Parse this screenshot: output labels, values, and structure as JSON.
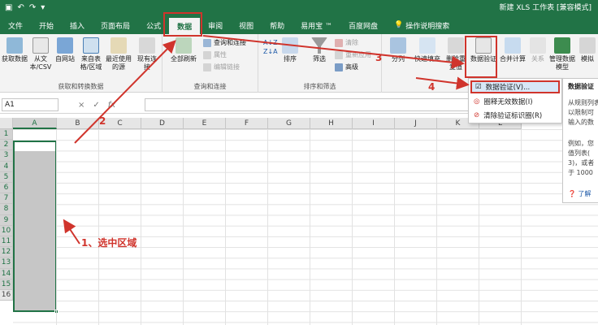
{
  "titlebar": {
    "title": "新建 XLS 工作表 [兼容模式]",
    "save_icon": "save-icon",
    "undo_icon": "undo-icon",
    "redo_icon": "redo-icon"
  },
  "tabs": [
    "文件",
    "开始",
    "插入",
    "页面布局",
    "公式",
    "数据",
    "审阅",
    "视图",
    "帮助",
    "易用宝 ™",
    "百度网盘",
    "操作说明搜索"
  ],
  "ribbon": {
    "get_group": {
      "label": "获取和转换数据",
      "buttons": [
        "获取数据",
        "从文本/CSV",
        "自网站",
        "来自表格/区域",
        "最近使用的源",
        "现有连接"
      ]
    },
    "query_group": {
      "label": "查询和连接",
      "refresh": "全部刷新",
      "items": [
        "查询和连接",
        "属性",
        "编辑链接"
      ]
    },
    "sort_group": {
      "label": "排序和筛选",
      "sort": "排序",
      "filter": "筛选",
      "items": [
        "清除",
        "重新应用",
        "高级"
      ]
    },
    "tools_group": {
      "buttons": [
        "分列",
        "快速填充",
        "删除重复值",
        "数据验证",
        "合并计算",
        "关系",
        "管理数据模型",
        "模拟"
      ]
    }
  },
  "formula_bar": {
    "name_box": "A1",
    "cancel": "×",
    "enter": "✓",
    "fx": "fx",
    "formula": ""
  },
  "grid": {
    "columns": [
      "A",
      "B",
      "C",
      "D",
      "E",
      "F",
      "G",
      "H",
      "I",
      "J",
      "K",
      "L"
    ],
    "rows": [
      "1",
      "2",
      "3",
      "4",
      "5",
      "6",
      "7",
      "8",
      "9",
      "10",
      "11",
      "12",
      "13",
      "14",
      "15",
      "16"
    ]
  },
  "dropdown": {
    "items": [
      "数据验证(V)...",
      "圈释无效数据(I)",
      "清除验证标识圈(R)"
    ]
  },
  "tooltip": {
    "title": "数据验证",
    "lines": [
      "从规则列表",
      "以限制可",
      "输入的数",
      "例如，您",
      "值列表(",
      "3)，或者",
      "于 1000"
    ],
    "help": "了解"
  },
  "annotations": {
    "step1": "1、选中区域",
    "step2": "2",
    "step3": "3",
    "step4": "4"
  },
  "colors": {
    "excel_green": "#217346",
    "annotation_red": "#d0342c",
    "selection_gray": "#c6c6c6"
  }
}
